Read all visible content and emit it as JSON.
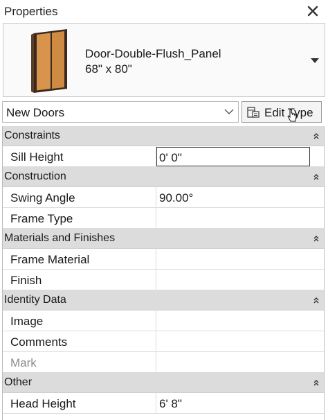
{
  "panel": {
    "title": "Properties"
  },
  "type_selector": {
    "family": "Door-Double-Flush_Panel",
    "size": "68\" x 80\""
  },
  "filter": {
    "selected": "New Doors"
  },
  "edit_type": {
    "label": "Edit Type"
  },
  "groups": [
    {
      "name": "Constraints",
      "rows": [
        {
          "name": "Sill Height",
          "value": "0'  0\""
        }
      ]
    },
    {
      "name": "Construction",
      "rows": [
        {
          "name": "Swing Angle",
          "value": "90.00°"
        },
        {
          "name": "Frame Type",
          "value": ""
        }
      ]
    },
    {
      "name": "Materials and Finishes",
      "rows": [
        {
          "name": "Frame Material",
          "value": ""
        },
        {
          "name": "Finish",
          "value": ""
        }
      ]
    },
    {
      "name": "Identity Data",
      "rows": [
        {
          "name": "Image",
          "value": ""
        },
        {
          "name": "Comments",
          "value": ""
        },
        {
          "name": "Mark",
          "value": ""
        }
      ]
    },
    {
      "name": "Other",
      "rows": [
        {
          "name": "Head Height",
          "value": "6'  8\""
        }
      ]
    }
  ]
}
